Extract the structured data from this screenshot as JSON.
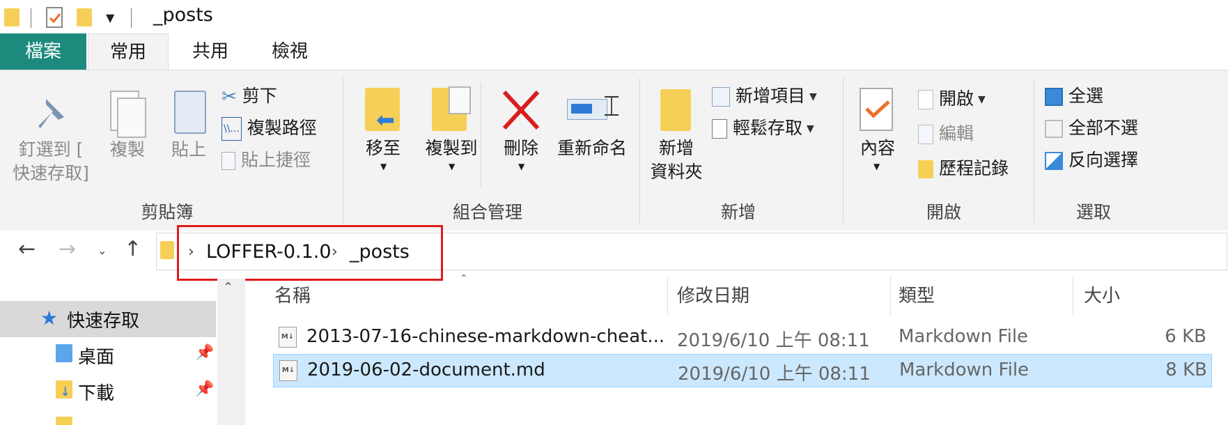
{
  "window": {
    "title": "_posts"
  },
  "ribbon": {
    "tabs": {
      "file": "檔案",
      "home": "常用",
      "share": "共用",
      "view": "檢視"
    },
    "clipboard": {
      "group_label": "剪貼簿",
      "pin_label_1": "釘選到 [",
      "pin_label_2": "快速存取]",
      "copy": "複製",
      "paste": "貼上",
      "cut": "剪下",
      "copy_path": "複製路徑",
      "paste_shortcut": "貼上捷徑"
    },
    "organize": {
      "group_label": "組合管理",
      "move_to": "移至",
      "copy_to": "複製到",
      "delete": "刪除",
      "rename": "重新命名"
    },
    "new": {
      "group_label": "新增",
      "new_folder_1": "新增",
      "new_folder_2": "資料夾",
      "new_item": "新增項目",
      "easy_access": "輕鬆存取"
    },
    "open": {
      "group_label": "開啟",
      "properties": "內容",
      "open": "開啟",
      "edit": "編輯",
      "history": "歷程記錄"
    },
    "select": {
      "group_label": "選取",
      "select_all": "全選",
      "select_none": "全部不選",
      "invert": "反向選擇"
    }
  },
  "address": {
    "crumbs": [
      "LOFFER-0.1.0",
      "_posts"
    ]
  },
  "nav": {
    "quick_access": "快速存取",
    "items": [
      "桌面",
      "下載"
    ]
  },
  "columns": {
    "name": "名稱",
    "modified": "修改日期",
    "type": "類型",
    "size": "大小"
  },
  "files": [
    {
      "name": "2013-07-16-chinese-markdown-cheat...",
      "modified": "2019/6/10 上午 08:11",
      "type": "Markdown File",
      "size": "6 KB"
    },
    {
      "name": "2019-06-02-document.md",
      "modified": "2019/6/10 上午 08:11",
      "type": "Markdown File",
      "size": "8 KB"
    }
  ],
  "colors": {
    "accent": "#1e8a7e",
    "selection": "#cce8ff",
    "highlight": "#e21b1b"
  }
}
